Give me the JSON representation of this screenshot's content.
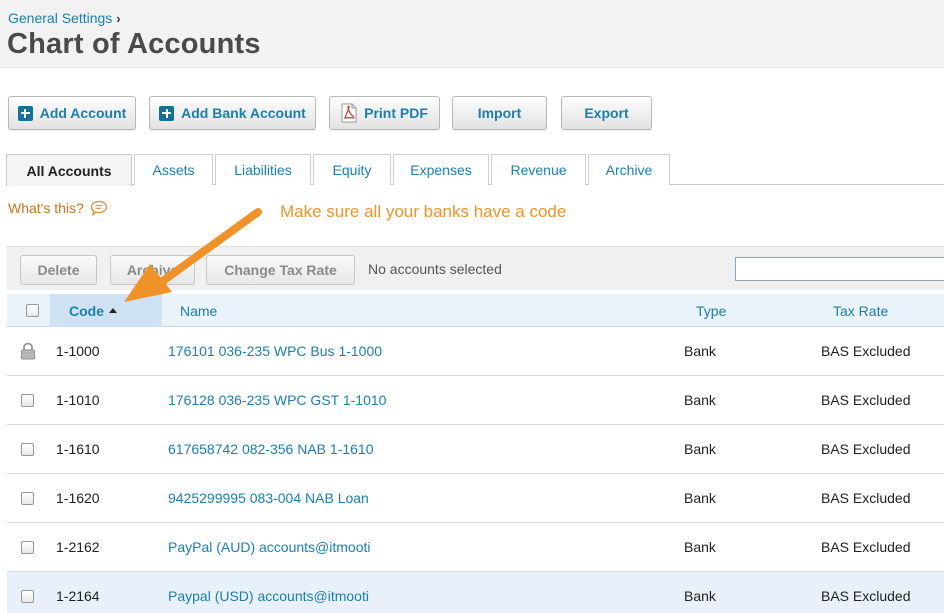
{
  "header": {
    "breadcrumb": "General Settings",
    "breadcrumb_chevron": "›",
    "title": "Chart of Accounts"
  },
  "toolbar": {
    "add_account": "Add Account",
    "add_bank_account": "Add Bank Account",
    "print_pdf": "Print PDF",
    "import": "Import",
    "export": "Export"
  },
  "tabs": [
    {
      "label": "All Accounts",
      "active": true
    },
    {
      "label": "Assets"
    },
    {
      "label": "Liabilities"
    },
    {
      "label": "Equity"
    },
    {
      "label": "Expenses"
    },
    {
      "label": "Revenue"
    },
    {
      "label": "Archive"
    }
  ],
  "help": {
    "whats_this": "What's this?",
    "annotation": "Make sure all your banks have a code"
  },
  "actions": {
    "delete": "Delete",
    "archive": "Archive",
    "change_tax_rate": "Change Tax Rate",
    "status": "No accounts selected",
    "search_value": ""
  },
  "table": {
    "columns": {
      "code": "Code",
      "name": "Name",
      "type": "Type",
      "tax_rate": "Tax Rate"
    },
    "rows": [
      {
        "code": "1-1000",
        "name": "176101 036-235 WPC Bus 1-1000",
        "type": "Bank",
        "tax_rate": "BAS Excluded",
        "locked": true
      },
      {
        "code": "1-1010",
        "name": "176128 036-235 WPC GST 1-1010",
        "type": "Bank",
        "tax_rate": "BAS Excluded"
      },
      {
        "code": "1-1610",
        "name": "617658742 082-356 NAB 1-1610",
        "type": "Bank",
        "tax_rate": "BAS Excluded"
      },
      {
        "code": "1-1620",
        "name": "9425299995 083-004 NAB Loan",
        "type": "Bank",
        "tax_rate": "BAS Excluded"
      },
      {
        "code": "1-2162",
        "name": "PayPal (AUD) accounts@itmooti",
        "type": "Bank",
        "tax_rate": "BAS Excluded"
      },
      {
        "code": "1-2164",
        "name": "Paypal (USD) accounts@itmooti",
        "type": "Bank",
        "tax_rate": "BAS Excluded",
        "highlighted": true
      }
    ]
  },
  "colors": {
    "link": "#1c7fae",
    "annotation": "#f0922a",
    "whats_this": "#c8761a"
  }
}
